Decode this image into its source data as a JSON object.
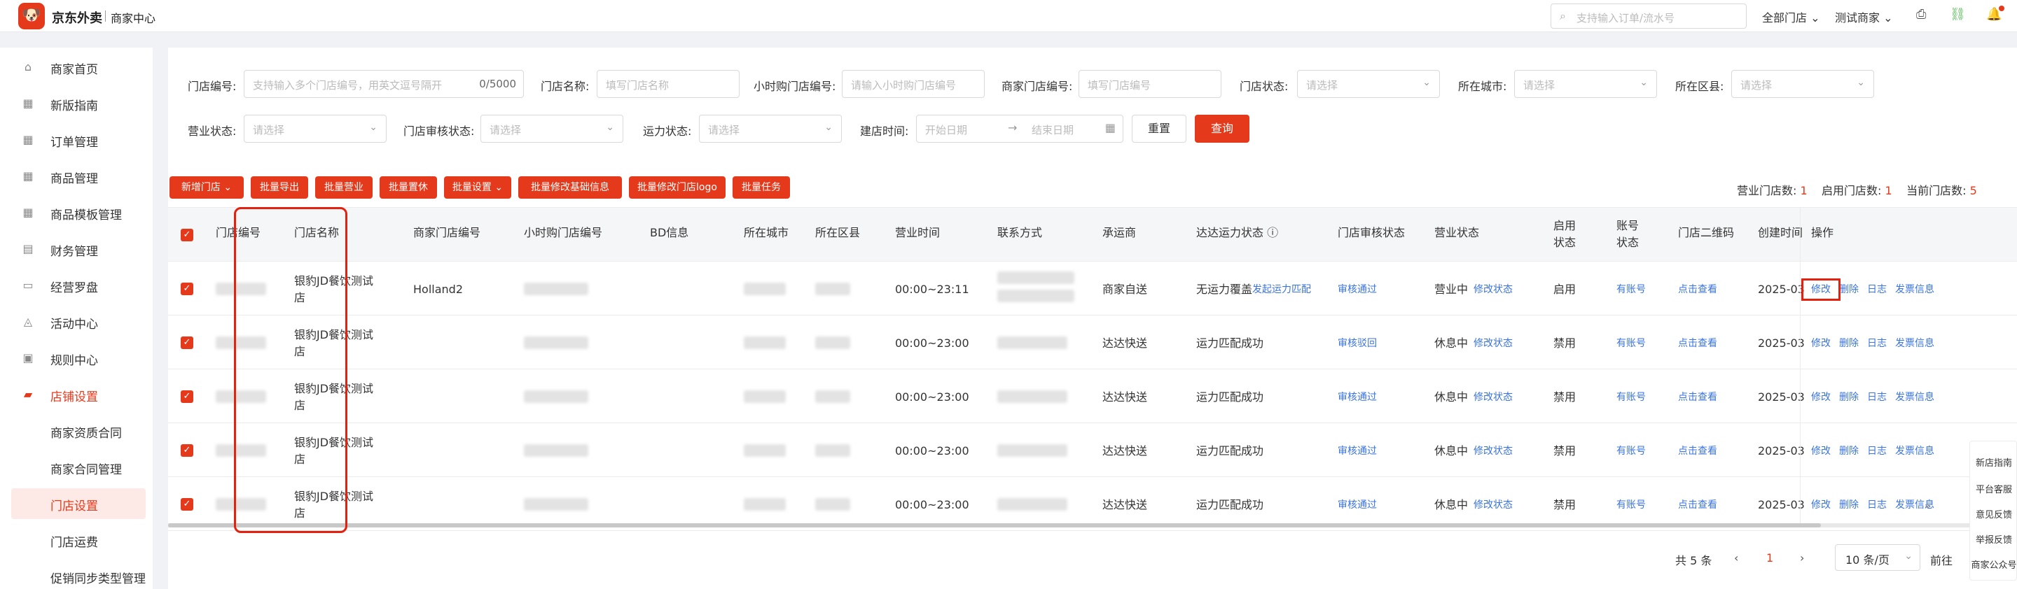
{
  "topbar": {
    "logo_glyph": "🐶",
    "logo_text": "京东外卖",
    "logo_sub": "商家中心",
    "search_placeholder": "支持输入订单/流水号",
    "store_selector": "全部门店",
    "user_selector": "测试商家"
  },
  "sidebar": {
    "items": [
      {
        "label": "商家首页",
        "icon": "home-icon",
        "glyph": "⌂"
      },
      {
        "label": "新版指南",
        "icon": "grid-icon",
        "glyph": "▦"
      },
      {
        "label": "订单管理",
        "icon": "grid-icon",
        "glyph": "▦"
      },
      {
        "label": "商品管理",
        "icon": "grid-icon",
        "glyph": "▦"
      },
      {
        "label": "商品模板管理",
        "icon": "grid-icon",
        "glyph": "▦"
      },
      {
        "label": "财务管理",
        "icon": "wallet-icon",
        "glyph": "▤"
      },
      {
        "label": "经营罗盘",
        "icon": "monitor-icon",
        "glyph": "▭"
      },
      {
        "label": "活动中心",
        "icon": "hat-icon",
        "glyph": "◬"
      },
      {
        "label": "规则中心",
        "icon": "rules-icon",
        "glyph": "▣"
      },
      {
        "label": "店铺设置",
        "icon": "store-icon",
        "glyph": "▰"
      }
    ],
    "sub_items": [
      {
        "label": "商家资质合同"
      },
      {
        "label": "商家合同管理"
      },
      {
        "label": "门店设置"
      },
      {
        "label": "门店运费"
      },
      {
        "label": "促销同步类型管理"
      }
    ]
  },
  "filters": {
    "store_no": {
      "label": "门店编号:",
      "placeholder": "支持输入多个门店编号，用英文逗号隔开",
      "counter": "0/5000"
    },
    "store_name": {
      "label": "门店名称:",
      "placeholder": "填写门店名称"
    },
    "hour_store_no": {
      "label": "小时购门店编号:",
      "placeholder": "请输入小时购门店编号"
    },
    "merchant_store_no": {
      "label": "商家门店编号:",
      "placeholder": "填写门店编号"
    },
    "store_status": {
      "label": "门店状态:",
      "placeholder": "请选择"
    },
    "city": {
      "label": "所在城市:",
      "placeholder": "请选择"
    },
    "district": {
      "label": "所在区县:",
      "placeholder": "请选择"
    },
    "business_status": {
      "label": "营业状态:",
      "placeholder": "请选择"
    },
    "audit_status": {
      "label": "门店审核状态:",
      "placeholder": "请选择"
    },
    "capacity_status": {
      "label": "运力状态:",
      "placeholder": "请选择"
    },
    "build_time": {
      "label": "建店时间:",
      "start_placeholder": "开始日期",
      "end_placeholder": "结束日期"
    },
    "reset_label": "重置",
    "query_label": "查询"
  },
  "actions": {
    "buttons": [
      "新增门店",
      "批量导出",
      "批量营业",
      "批量置休",
      "批量设置",
      "批量修改基础信息",
      "批量修改门店logo",
      "批量任务"
    ],
    "counts": {
      "open_label": "营业门店数:",
      "open_value": "1",
      "enabled_label": "启用门店数:",
      "enabled_value": "1",
      "current_label": "当前门店数:",
      "current_value": "5"
    }
  },
  "table": {
    "headers": [
      "门店编号",
      "门店名称",
      "商家门店编号",
      "小时购门店编号",
      "BD信息",
      "所在城市",
      "所在区县",
      "营业时间",
      "联系方式",
      "承运商",
      "达达运力状态",
      "门店审核状态",
      "营业状态",
      "启用状态",
      "账号状态",
      "门店二维码",
      "创建时间",
      "操作"
    ],
    "rows": [
      {
        "name": "银豹JD餐饮测试店",
        "merchant_no": "Holland2",
        "hours": "00:00~23:11",
        "carrier": "商家自送",
        "dada": "无运力覆盖",
        "dada_link": "发起运力匹配",
        "audit": "审核通过",
        "business": "营业中",
        "business_link": "修改状态",
        "enable": "启用",
        "account": "有账号",
        "qrcode": "点击查看",
        "created": "2025-03",
        "ops": [
          "修改",
          "删除",
          "日志",
          "发票信息"
        ]
      },
      {
        "name": "银豹JD餐饮测试店",
        "merchant_no": "",
        "hours": "00:00~23:00",
        "carrier": "达达快送",
        "dada": "运力匹配成功",
        "dada_link": "",
        "audit": "审核驳回",
        "business": "休息中",
        "business_link": "修改状态",
        "enable": "禁用",
        "account": "有账号",
        "qrcode": "点击查看",
        "created": "2025-03",
        "ops": [
          "修改",
          "删除",
          "日志",
          "发票信息"
        ]
      },
      {
        "name": "银豹JD餐饮测试店",
        "merchant_no": "",
        "hours": "00:00~23:00",
        "carrier": "达达快送",
        "dada": "运力匹配成功",
        "dada_link": "",
        "audit": "审核通过",
        "business": "休息中",
        "business_link": "修改状态",
        "enable": "禁用",
        "account": "有账号",
        "qrcode": "点击查看",
        "created": "2025-03",
        "ops": [
          "修改",
          "删除",
          "日志",
          "发票信息"
        ]
      },
      {
        "name": "银豹JD餐饮测试店",
        "merchant_no": "",
        "hours": "00:00~23:00",
        "carrier": "达达快送",
        "dada": "运力匹配成功",
        "dada_link": "",
        "audit": "审核通过",
        "business": "休息中",
        "business_link": "修改状态",
        "enable": "禁用",
        "account": "有账号",
        "qrcode": "点击查看",
        "created": "2025-03",
        "ops": [
          "修改",
          "删除",
          "日志",
          "发票信息"
        ]
      },
      {
        "name": "银豹JD餐饮测试店",
        "merchant_no": "",
        "hours": "00:00~23:00",
        "carrier": "达达快送",
        "dada": "运力匹配成功",
        "dada_link": "",
        "audit": "审核通过",
        "business": "休息中",
        "business_link": "修改状态",
        "enable": "禁用",
        "account": "有账号",
        "qrcode": "点击查看",
        "created": "2025-03",
        "ops": [
          "修改",
          "删除",
          "日志",
          "发票信息"
        ]
      }
    ]
  },
  "pagination": {
    "total_label": "共 5 条",
    "current_page": "1",
    "page_size": "10 条/页",
    "goto_label": "前往"
  },
  "help": {
    "items": [
      "新店指南",
      "平台客服",
      "意见反馈",
      "举报反馈",
      "商家公众号"
    ],
    "toggle_glyph": "»"
  },
  "colors": {
    "brand": "#e4391b",
    "link": "#3a74e0",
    "highlight": "#e4200e"
  }
}
